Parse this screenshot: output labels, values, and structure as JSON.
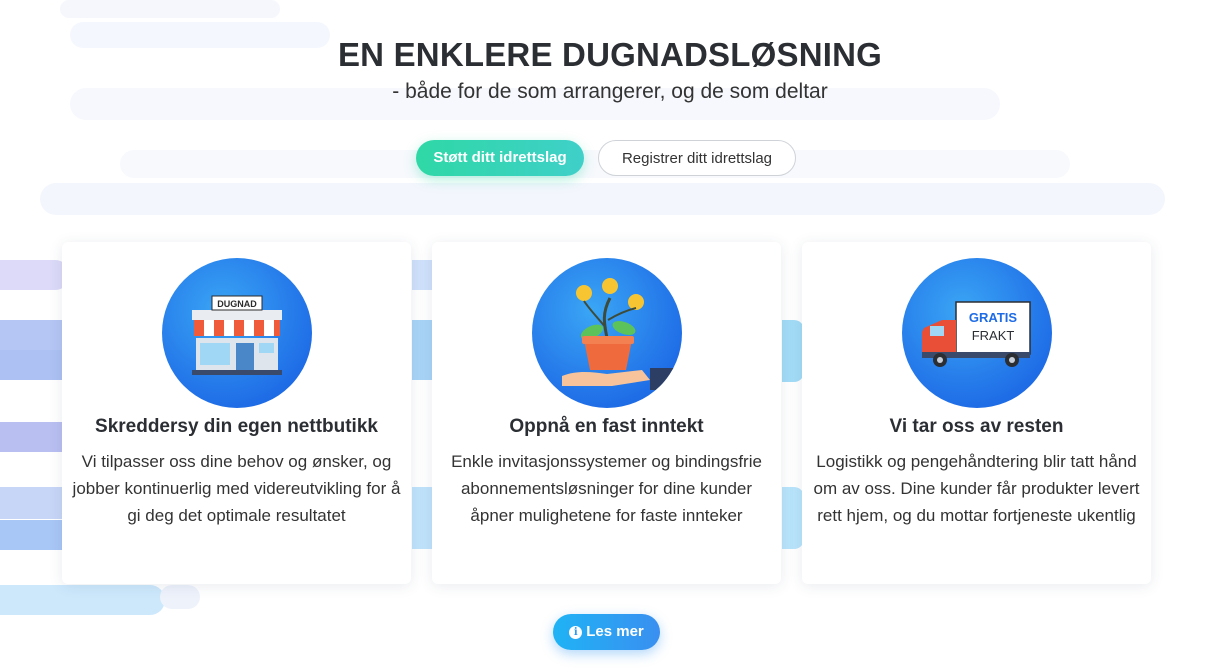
{
  "hero": {
    "title": "EN ENKLERE DUGNADSLØSNING",
    "subtitle": "- både for de som arrangerer, og de som deltar"
  },
  "actions": {
    "primary_label": "Støtt ditt idrettslag",
    "secondary_label": "Registrer ditt idrettslag"
  },
  "cards": [
    {
      "icon": "shop-icon",
      "sign_text": "DUGNAD",
      "title": "Skreddersy din egen nettbutikk",
      "text": "Vi tilpasser oss dine behov og ønsker, og jobber kontinuerlig med videreutvikling for å gi deg det optimale resultatet"
    },
    {
      "icon": "money-plant-icon",
      "title": "Oppnå en fast inntekt",
      "text": "Enkle invitasjonssystemer og bindingsfrie abonnementsløsninger for dine kunder åpner mulighetene for faste innteker"
    },
    {
      "icon": "delivery-truck-icon",
      "truck_text_1": "GRATIS",
      "truck_text_2": "FRAKT",
      "title": "Vi tar oss av resten",
      "text": "Logistikk og pengehåndtering blir tatt hånd om av oss. Dine kunder får produkter levert rett hjem, og du mottar fortjeneste ukentlig"
    }
  ],
  "more_button": {
    "label": "Les mer",
    "icon": "info-icon"
  },
  "colors": {
    "primary_green": "#2fd8a6",
    "accent_blue": "#1e6be6",
    "button_blue": "#1fb3f5"
  }
}
